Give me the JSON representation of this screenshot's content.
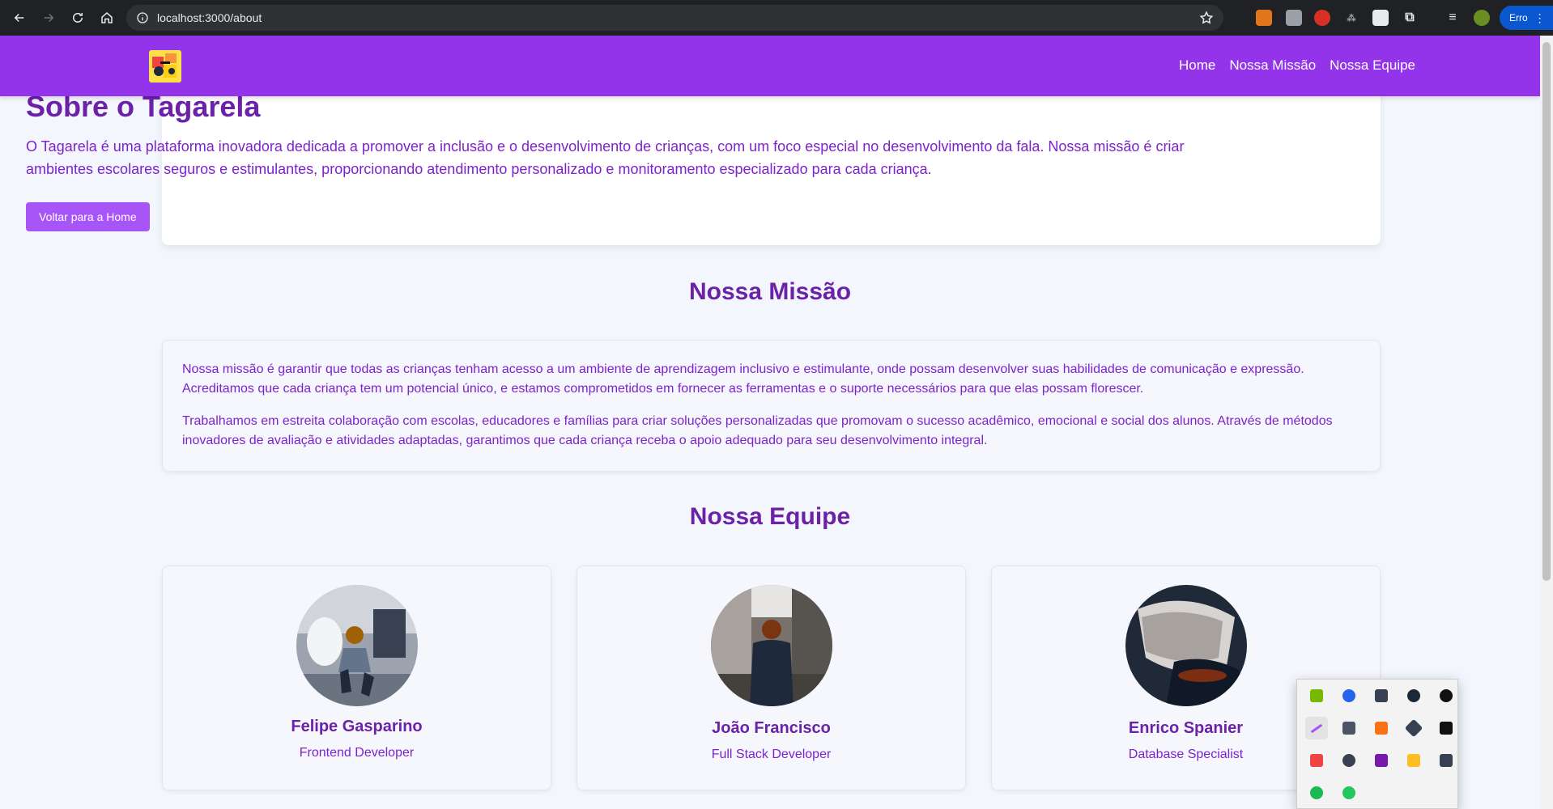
{
  "browser": {
    "url": "localhost:3000/about",
    "profile_label": "Erro"
  },
  "header": {
    "nav": [
      "Home",
      "Nossa Missão",
      "Nossa Equipe"
    ]
  },
  "hero": {
    "title": "Sobre o Tagarela",
    "text": "O Tagarela é uma plataforma inovadora dedicada a promover a inclusão e o desenvolvimento de crianças, com um foco especial no desenvolvimento da fala. Nossa missão é criar ambientes escolares seguros e estimulantes, proporcionando atendimento personalizado e monitoramento especializado para cada criança.",
    "button": "Voltar para a Home"
  },
  "mission": {
    "title": "Nossa Missão",
    "paragraphs": [
      "Nossa missão é garantir que todas as crianças tenham acesso a um ambiente de aprendizagem inclusivo e estimulante, onde possam desenvolver suas habilidades de comunicação e expressão. Acreditamos que cada criança tem um potencial único, e estamos comprometidos em fornecer as ferramentas e o suporte necessários para que elas possam florescer.",
      "Trabalhamos em estreita colaboração com escolas, educadores e famílias para criar soluções personalizadas que promovam o sucesso acadêmico, emocional e social dos alunos. Através de métodos inovadores de avaliação e atividades adaptadas, garantimos que cada criança receba o apoio adequado para seu desenvolvimento integral."
    ]
  },
  "team": {
    "title": "Nossa Equipe",
    "members": [
      {
        "name": "Felipe Gasparino",
        "role": "Frontend Developer"
      },
      {
        "name": "João Francisco",
        "role": "Full Stack Developer"
      },
      {
        "name": "Enrico Spanier",
        "role": "Database Specialist"
      }
    ]
  },
  "colors": {
    "header": "#9333ea",
    "title": "#6b21a8",
    "text": "#7e22ce",
    "button": "#a855f7"
  }
}
